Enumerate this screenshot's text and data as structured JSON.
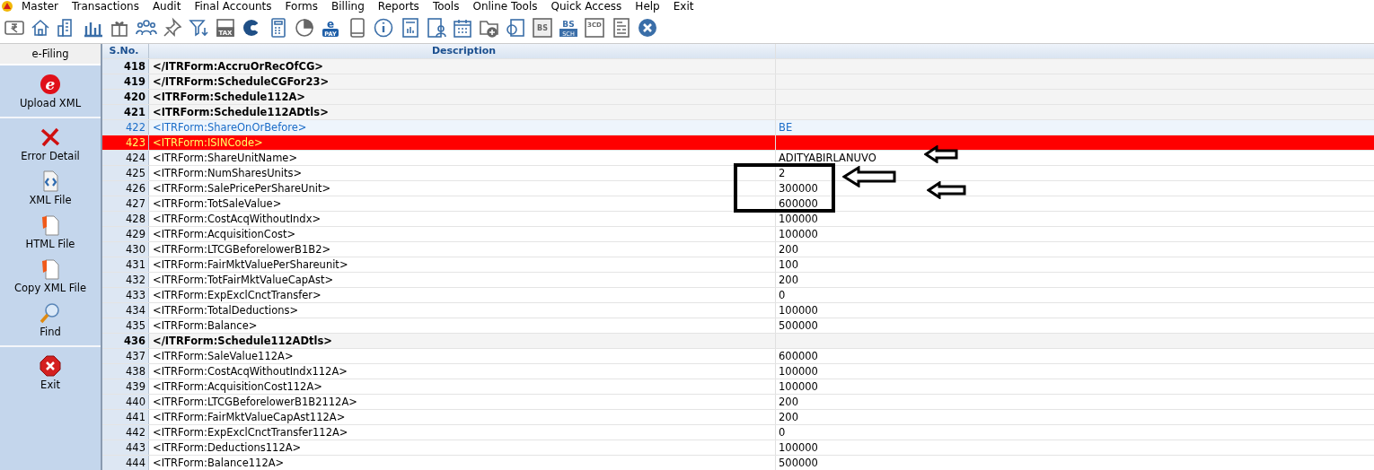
{
  "menu": [
    "Master",
    "Transactions",
    "Audit",
    "Final Accounts",
    "Forms",
    "Billing",
    "Reports",
    "Tools",
    "Online Tools",
    "Quick Access",
    "Help",
    "Exit"
  ],
  "toolbar": [
    {
      "kind": "rupee"
    },
    {
      "kind": "home"
    },
    {
      "kind": "building"
    },
    {
      "kind": "bars"
    },
    {
      "kind": "gift"
    },
    {
      "kind": "people"
    },
    {
      "kind": "pin"
    },
    {
      "kind": "filter"
    },
    {
      "kind": "tax",
      "text": "TAX"
    },
    {
      "kind": "pacman"
    },
    {
      "kind": "calculator"
    },
    {
      "kind": "pie"
    },
    {
      "kind": "epay",
      "text": "e",
      "text2": "PAY"
    },
    {
      "kind": "book"
    },
    {
      "kind": "info"
    },
    {
      "kind": "report"
    },
    {
      "kind": "contact"
    },
    {
      "kind": "calendar"
    },
    {
      "kind": "folder"
    },
    {
      "kind": "copy"
    },
    {
      "kind": "bs",
      "text": "BS"
    },
    {
      "kind": "bssch",
      "text": "BS",
      "text2": "SCH"
    },
    {
      "kind": "cd",
      "text": "3CD"
    },
    {
      "kind": "grid"
    },
    {
      "kind": "close"
    }
  ],
  "sidebar": {
    "title": "e-Filing",
    "sections": [
      [
        {
          "kind": "efile",
          "badge": "e",
          "label": "Upload XML"
        }
      ],
      [
        {
          "kind": "error",
          "label": "Error Detail"
        },
        {
          "kind": "xml",
          "label": "XML File"
        },
        {
          "kind": "html",
          "label": "HTML File"
        },
        {
          "kind": "html",
          "label": "Copy XML File"
        },
        {
          "kind": "find",
          "label": "Find"
        }
      ],
      [
        {
          "kind": "exit",
          "label": "Exit"
        }
      ]
    ]
  },
  "table": {
    "columns": [
      "S.No.",
      "Description"
    ],
    "rows": [
      {
        "sno": "418",
        "description": "</ITRForm:AccruOrRecOfCG>",
        "kind": "group",
        "selected": false
      },
      {
        "sno": "419",
        "description": "</ITRForm:ScheduleCGFor23>",
        "kind": "group",
        "selected": false
      },
      {
        "sno": "420",
        "description": "<ITRForm:Schedule112A>",
        "kind": "group",
        "selected": false
      },
      {
        "sno": "421",
        "description": "<ITRForm:Schedule112ADtls>",
        "kind": "group",
        "selected": false
      },
      {
        "sno": "422",
        "description": "<ITRForm:ShareOnOrBefore>",
        "value": "BE",
        "kind": "link",
        "selected": false
      },
      {
        "sno": "423",
        "description": "<ITRForm:ISINCode>",
        "kind": "field",
        "selected": true
      },
      {
        "sno": "424",
        "description": "<ITRForm:ShareUnitName>",
        "value": "ADITYABIRLANUVO",
        "kind": "field",
        "selected": false
      },
      {
        "sno": "425",
        "description": "<ITRForm:NumSharesUnits>",
        "value": "2",
        "kind": "field",
        "selected": false
      },
      {
        "sno": "426",
        "description": "<ITRForm:SalePricePerShareUnit>",
        "value": "300000",
        "kind": "field",
        "selected": false
      },
      {
        "sno": "427",
        "description": "<ITRForm:TotSaleValue>",
        "value": "600000",
        "kind": "field",
        "selected": false
      },
      {
        "sno": "428",
        "description": "<ITRForm:CostAcqWithoutIndx>",
        "value": "100000",
        "kind": "field",
        "selected": false
      },
      {
        "sno": "429",
        "description": "<ITRForm:AcquisitionCost>",
        "value": "100000",
        "kind": "field",
        "selected": false
      },
      {
        "sno": "430",
        "description": "<ITRForm:LTCGBeforelowerB1B2>",
        "value": "200",
        "kind": "field",
        "selected": false
      },
      {
        "sno": "431",
        "description": "<ITRForm:FairMktValuePerShareunit>",
        "value": "100",
        "kind": "field",
        "selected": false
      },
      {
        "sno": "432",
        "description": "<ITRForm:TotFairMktValueCapAst>",
        "value": "200",
        "kind": "field",
        "selected": false
      },
      {
        "sno": "433",
        "description": "<ITRForm:ExpExclCnctTransfer>",
        "value": "0",
        "kind": "field",
        "selected": false
      },
      {
        "sno": "434",
        "description": "<ITRForm:TotalDeductions>",
        "value": "100000",
        "kind": "field",
        "selected": false
      },
      {
        "sno": "435",
        "description": "<ITRForm:Balance>",
        "value": "500000",
        "kind": "field",
        "selected": false
      },
      {
        "sno": "436",
        "description": "</ITRForm:Schedule112ADtls>",
        "kind": "group",
        "selected": false
      },
      {
        "sno": "437",
        "description": "<ITRForm:SaleValue112A>",
        "value": "600000",
        "kind": "field",
        "selected": false
      },
      {
        "sno": "438",
        "description": "<ITRForm:CostAcqWithoutIndx112A>",
        "value": "100000",
        "kind": "field",
        "selected": false
      },
      {
        "sno": "439",
        "description": "<ITRForm:AcquisitionCost112A>",
        "value": "100000",
        "kind": "field",
        "selected": false
      },
      {
        "sno": "440",
        "description": "<ITRForm:LTCGBeforelowerB1B2112A>",
        "value": "200",
        "kind": "field",
        "selected": false
      },
      {
        "sno": "441",
        "description": "<ITRForm:FairMktValueCapAst112A>",
        "value": "200",
        "kind": "field",
        "selected": false
      },
      {
        "sno": "442",
        "description": "<ITRForm:ExpExclCnctTransfer112A>",
        "value": "0",
        "kind": "field",
        "selected": false
      },
      {
        "sno": "443",
        "description": "<ITRForm:Deductions112A>",
        "value": "100000",
        "kind": "field",
        "selected": false
      },
      {
        "sno": "444",
        "description": "<ITRForm:Balance112A>",
        "value": "500000",
        "kind": "field",
        "selected": false
      }
    ]
  }
}
